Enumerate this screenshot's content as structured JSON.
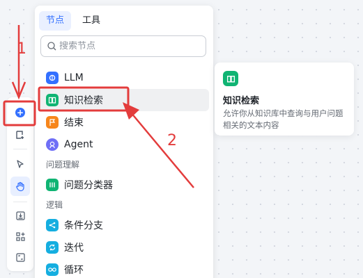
{
  "tabs": [
    {
      "label": "节点",
      "active": true
    },
    {
      "label": "工具",
      "active": false
    }
  ],
  "search": {
    "placeholder": "搜索节点"
  },
  "items": [
    {
      "label": "LLM",
      "icon": "brain-icon",
      "color": "#3370ff"
    },
    {
      "label": "知识检索",
      "icon": "book-icon",
      "color": "#10b473"
    },
    {
      "label": "结束",
      "icon": "flag-icon",
      "color": "#f7861b"
    },
    {
      "label": "Agent",
      "icon": "robot-icon",
      "color": "#6f6ff6"
    },
    {
      "label": "问题分类器",
      "icon": "classifier-icon",
      "color": "#10b473"
    },
    {
      "label": "条件分支",
      "icon": "branch-icon",
      "color": "#15aee0"
    },
    {
      "label": "迭代",
      "icon": "loop-arrows-icon",
      "color": "#15aee0"
    },
    {
      "label": "循环",
      "icon": "infinity-icon",
      "color": "#15aee0"
    }
  ],
  "sections": {
    "question_understanding": "问题理解",
    "logic": "逻辑"
  },
  "card": {
    "title": "知识检索",
    "description": "允许你从知识库中查询与用户问题相关的文本内容",
    "icon": "book-icon",
    "color": "#10b473"
  },
  "annotations": {
    "step1": "1",
    "step2": "2",
    "color": "#e33c3c"
  }
}
